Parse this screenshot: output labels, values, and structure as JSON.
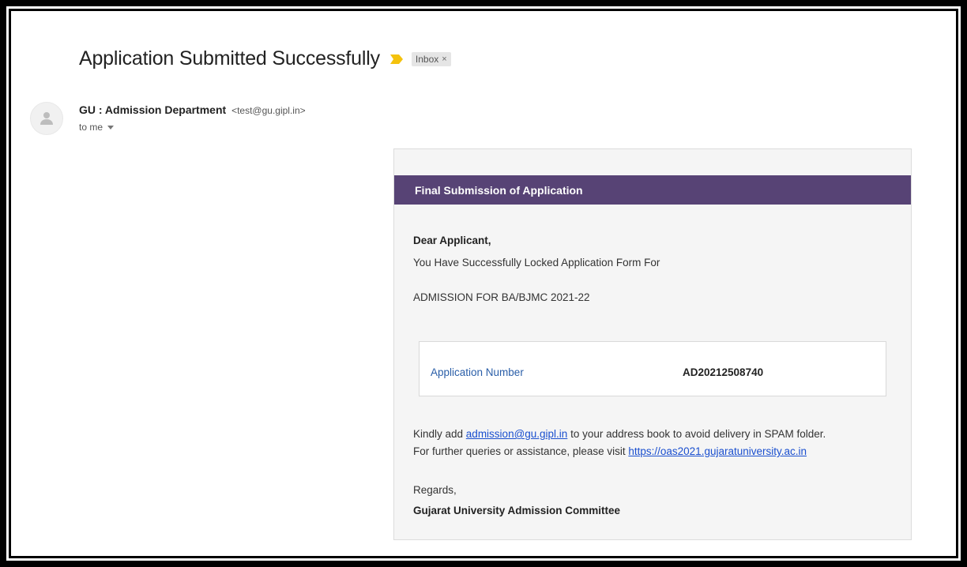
{
  "subject": "Application Submitted Successfully",
  "label": {
    "text": "Inbox",
    "close_glyph": "×"
  },
  "icons": {
    "importance": "importance-marker-icon",
    "avatar": "person-icon",
    "caret": "caret-down-icon",
    "label_close": "close-icon"
  },
  "colors": {
    "header_bg": "#574375",
    "importance": "#f4c20d",
    "link": "#1a4fcf",
    "label_blue": "#2a5ea8"
  },
  "sender": {
    "name": "GU : Admission Department",
    "email": "<test@gu.gipl.in>",
    "to": "to me"
  },
  "card": {
    "header": "Final Submission of Application",
    "greeting": "Dear Applicant,",
    "locked_line": "You Have Successfully Locked Application Form For",
    "admission_line": "ADMISSION FOR BA/BJMC 2021-22",
    "app_number_label": "Application Number",
    "app_number_value": "AD20212508740",
    "note1_prefix": "Kindly add ",
    "note1_link": "admission@gu.gipl.in",
    "note1_suffix": " to your address book to avoid delivery in SPAM folder.",
    "note2_prefix": "For further queries or assistance, please visit ",
    "note2_link": "https://oas2021.gujaratuniversity.ac.in",
    "regards": "Regards,",
    "committee": "Gujarat University Admission Committee"
  }
}
